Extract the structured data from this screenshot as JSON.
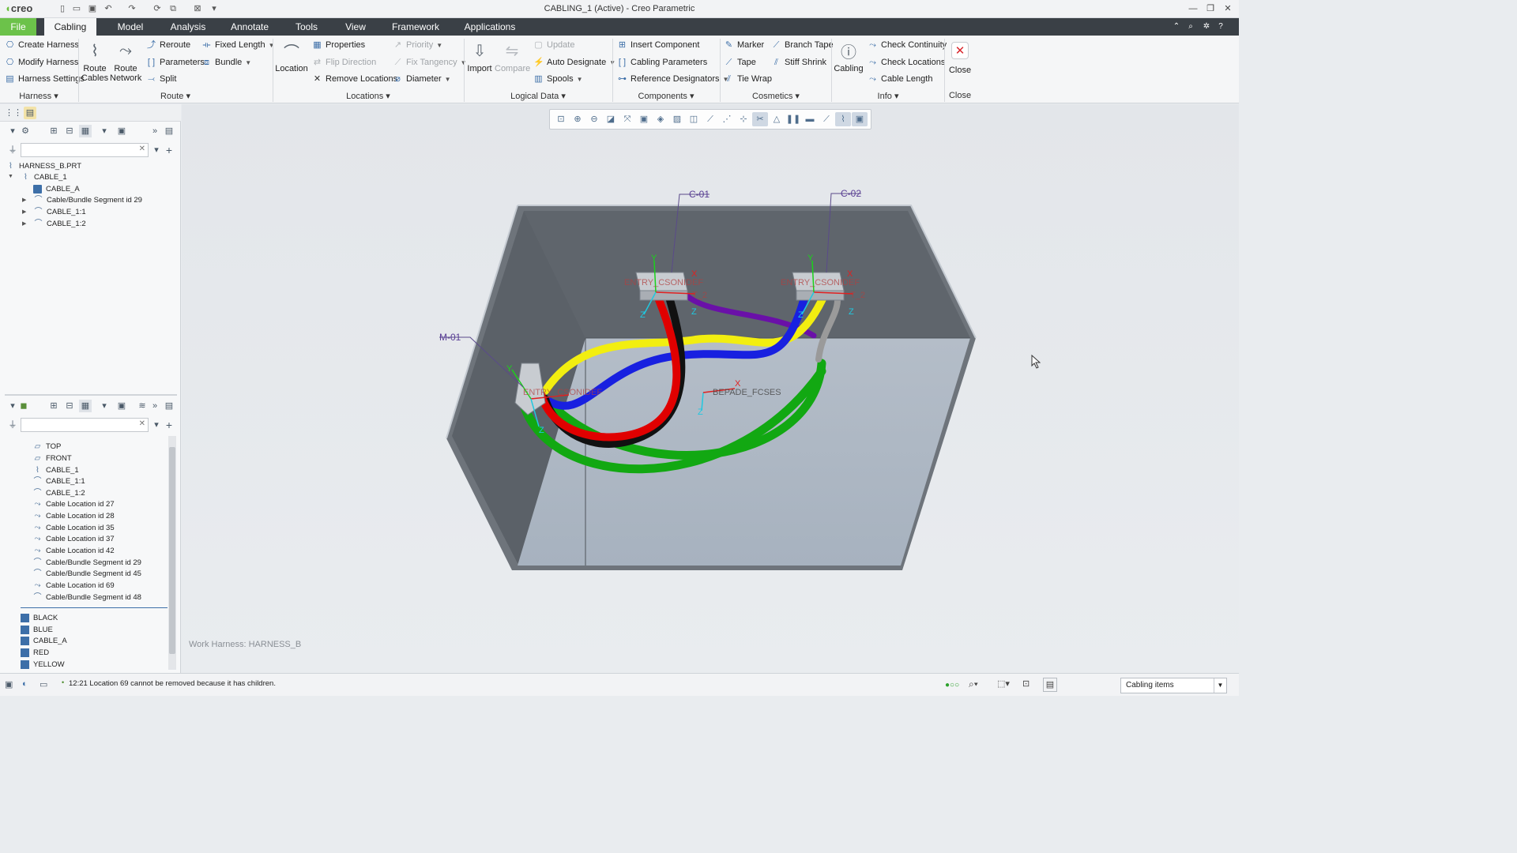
{
  "window": {
    "app_logo": "creo",
    "title": "CABLING_1 (Active) - Creo Parametric"
  },
  "menu": {
    "file": "File",
    "tabs": [
      "Cabling",
      "Model",
      "Analysis",
      "Annotate",
      "Tools",
      "View",
      "Framework",
      "Applications"
    ]
  },
  "ribbon": {
    "harness": {
      "create": "Create Harness",
      "modify": "Modify Harness",
      "settings": "Harness Settings",
      "group": "Harness"
    },
    "route": {
      "route_cables": "Route Cables",
      "route_network": "Route Network",
      "reroute": "Reroute",
      "parameters": "Parameters",
      "split": "Split",
      "fixed_length": "Fixed Length",
      "bundle": "Bundle",
      "group": "Route"
    },
    "locations": {
      "location": "Location",
      "properties": "Properties",
      "flip_direction": "Flip Direction",
      "remove_locations": "Remove Locations",
      "priority": "Priority",
      "fix_tangency": "Fix Tangency",
      "diameter": "Diameter",
      "group": "Locations"
    },
    "logical_data": {
      "import": "Import",
      "compare": "Compare",
      "update": "Update",
      "auto_designate": "Auto Designate",
      "spools": "Spools",
      "group": "Logical Data"
    },
    "components": {
      "insert_component": "Insert Component",
      "cabling_parameters": "Cabling Parameters",
      "reference_designators": "Reference Designators",
      "group": "Components"
    },
    "cosmetics": {
      "marker": "Marker",
      "tape": "Tape",
      "tie_wrap": "Tie Wrap",
      "branch_tape": "Branch Tape",
      "stiff_shrink": "Stiff Shrink",
      "group": "Cosmetics"
    },
    "info": {
      "cabling": "Cabling",
      "check_continuity": "Check Continuity",
      "check_locations": "Check Locations",
      "cable_length": "Cable Length",
      "group": "Info"
    },
    "close": {
      "close": "Close",
      "group": "Close"
    }
  },
  "tree_top": {
    "items": [
      {
        "label": "HARNESS_B.PRT",
        "icon": "harness-icon"
      },
      {
        "label": "CABLE_1",
        "icon": "cable-icon"
      },
      {
        "label": "CABLE_A",
        "icon": "spool-icon"
      },
      {
        "label": "Cable/Bundle Segment id 29",
        "icon": "segment-icon"
      },
      {
        "label": "CABLE_1:1",
        "icon": "segment-icon"
      },
      {
        "label": "CABLE_1:2",
        "icon": "segment-icon"
      }
    ]
  },
  "tree_bottom": {
    "items": [
      {
        "label": "TOP",
        "icon": "datum-plane-icon"
      },
      {
        "label": "FRONT",
        "icon": "datum-plane-icon"
      },
      {
        "label": "CABLE_1",
        "icon": "cable-icon"
      },
      {
        "label": "CABLE_1:1",
        "icon": "segment-icon"
      },
      {
        "label": "CABLE_1:2",
        "icon": "segment-icon"
      },
      {
        "label": "Cable Location id 27",
        "icon": "location-icon"
      },
      {
        "label": "Cable Location id 28",
        "icon": "location-icon"
      },
      {
        "label": "Cable Location id 35",
        "icon": "location-icon"
      },
      {
        "label": "Cable Location id 37",
        "icon": "location-icon"
      },
      {
        "label": "Cable Location id 42",
        "icon": "location-icon"
      },
      {
        "label": "Cable/Bundle Segment id 29",
        "icon": "segment-icon"
      },
      {
        "label": "Cable/Bundle Segment id 45",
        "icon": "segment-icon"
      },
      {
        "label": "Cable Location id 69",
        "icon": "location-icon"
      },
      {
        "label": "Cable/Bundle Segment id 48",
        "icon": "segment-icon"
      }
    ],
    "spools": [
      "BLACK",
      "BLUE",
      "CABLE_A",
      "RED",
      "YELLOW"
    ]
  },
  "viewport": {
    "work_harness": "Work Harness: HARNESS_B",
    "labels": {
      "c01": "C-01",
      "c02": "C-02",
      "m01": "M-01",
      "conn1": "ENTRY_CSONIDEF",
      "conn1b": "T_2",
      "conn2": "ENTRY_CSONIDEF",
      "conn2b": "T_2",
      "conn3": "ENTRY_CSONIDEF",
      "center": "BEPADE_FCSES"
    },
    "wire_colors": {
      "red": "#e00000",
      "black": "#111111",
      "blue": "#1820e0",
      "yellow": "#f2ee10",
      "green": "#12a812",
      "purple": "#6a10a8",
      "gray": "#9a9a9a"
    }
  },
  "status": {
    "message": "12:21 Location 69 cannot be removed because it has children.",
    "filter": "Cabling items"
  }
}
